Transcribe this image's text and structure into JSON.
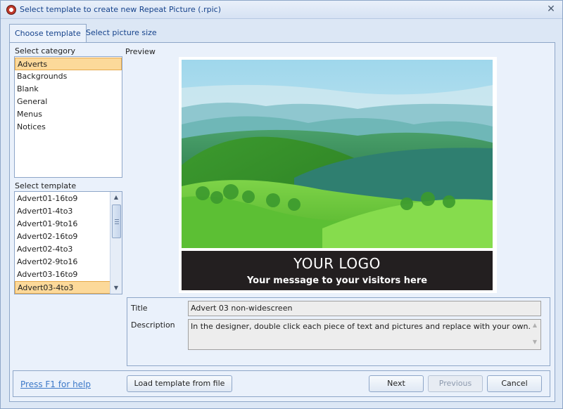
{
  "window": {
    "title": "Select template to create new Repeat Picture (.rpic)",
    "close_glyph": "✕"
  },
  "tabs": [
    {
      "label": "Choose template",
      "active": true
    },
    {
      "label": "Select picture size",
      "active": false
    }
  ],
  "category": {
    "label": "Select category",
    "items": [
      "Adverts",
      "Backgrounds",
      "Blank",
      "General",
      "Menus",
      "Notices"
    ],
    "selected": "Adverts"
  },
  "template": {
    "label": "Select template",
    "items": [
      "Advert01-16to9",
      "Advert01-4to3",
      "Advert01-9to16",
      "Advert02-16to9",
      "Advert02-4to3",
      "Advert02-9to16",
      "Advert03-16to9",
      "Advert03-4to3"
    ],
    "selected": "Advert03-4to3"
  },
  "preview": {
    "label": "Preview",
    "logo_text": "YOUR LOGO",
    "message_text": "Your message to your visitors here"
  },
  "details": {
    "title_label": "Title",
    "title_value": "Advert 03 non-widescreen",
    "description_label": "Description",
    "description_value": "In the designer, double click each piece of text and pictures and replace with your own."
  },
  "footer": {
    "help_link": "Press F1 for help",
    "load_button": "Load template from file",
    "next_button": "Next",
    "previous_button": "Previous",
    "cancel_button": "Cancel"
  },
  "colors": {
    "selection_fill": "#fcd99a",
    "accent_blue": "#15428b",
    "link_blue": "#3d79c8",
    "banner_dark": "#231f20"
  },
  "icons": {
    "app": "repeat-picture-app-icon",
    "close": "close-icon",
    "scroll_up": "scroll-up-arrow-icon",
    "scroll_down": "scroll-down-arrow-icon"
  }
}
